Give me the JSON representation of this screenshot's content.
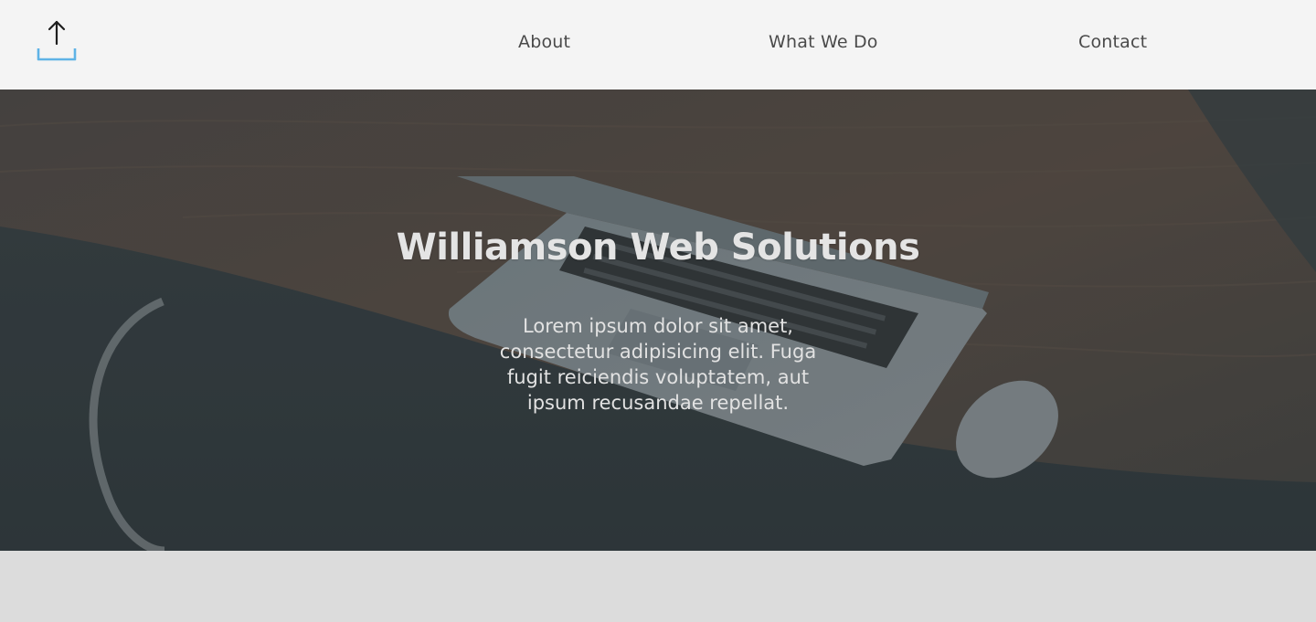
{
  "header": {
    "logo_icon": "upload-icon",
    "logo_color": "#5fb3e6",
    "nav": [
      {
        "label": "About"
      },
      {
        "label": "What We Do"
      },
      {
        "label": "Contact"
      }
    ]
  },
  "hero": {
    "title": "Williamson Web Solutions",
    "text": "Lorem ipsum dolor sit amet, consectetur adipisicing elit. Fuga fugit reiciendis voluptatem, aut ipsum recusandae repellat."
  },
  "colors": {
    "header_bg": "#f4f4f4",
    "hero_overlay": "#2f393d",
    "footer_bg": "#dcdcdc",
    "nav_text": "#4a4a4a"
  }
}
